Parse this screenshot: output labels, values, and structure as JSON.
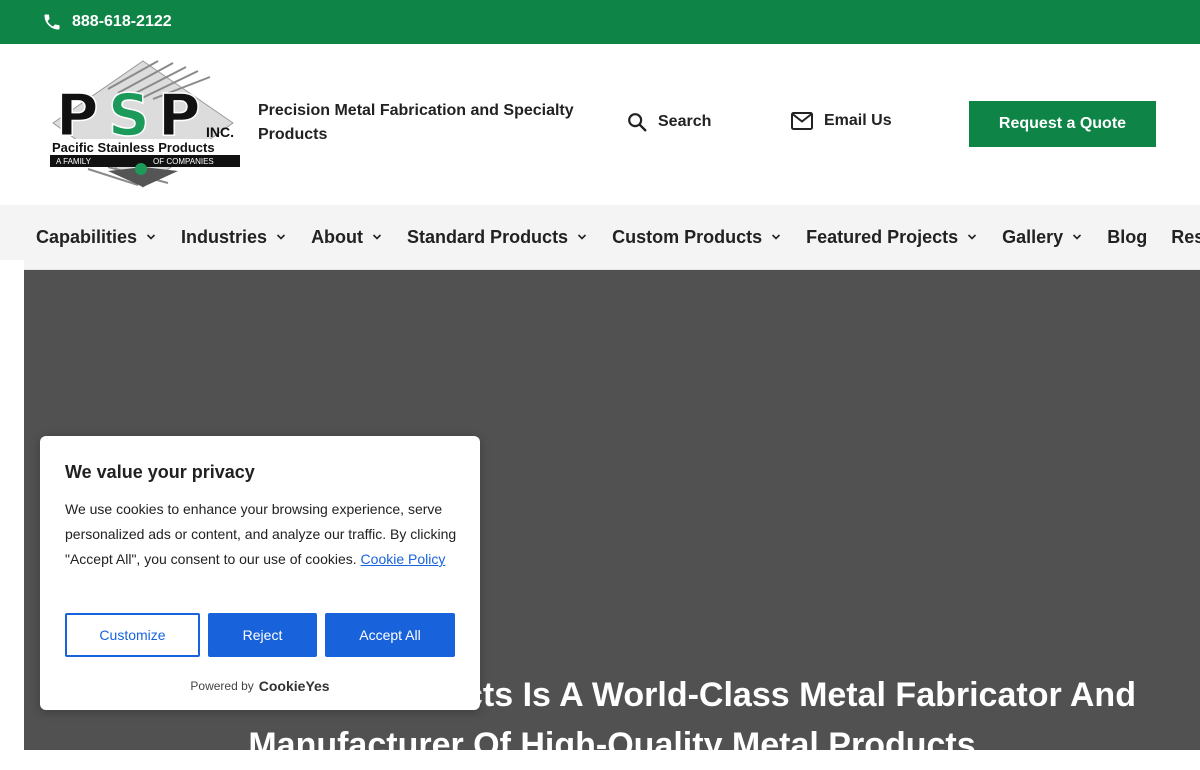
{
  "topbar": {
    "phone": "888-618-2122"
  },
  "header": {
    "logo": {
      "main": "PSP",
      "inc": "INC.",
      "company": "Pacific Stainless Products",
      "sub_left": "A FAMILY",
      "sub_right": "OF COMPANIES"
    },
    "tagline": "Precision Metal Fabrication and Specialty Products",
    "search_label": "Search",
    "email_label": "Email Us",
    "quote_label": "Request a Quote"
  },
  "nav": {
    "items": [
      {
        "label": "Capabilities",
        "dropdown": true
      },
      {
        "label": "Industries",
        "dropdown": true
      },
      {
        "label": "About",
        "dropdown": true
      },
      {
        "label": "Standard Products",
        "dropdown": true
      },
      {
        "label": "Custom Products",
        "dropdown": true
      },
      {
        "label": "Featured Projects",
        "dropdown": true
      },
      {
        "label": "Gallery",
        "dropdown": true
      },
      {
        "label": "Blog",
        "dropdown": false
      },
      {
        "label": "Res",
        "dropdown": false
      }
    ]
  },
  "hero": {
    "title": "Pacific Stainless Products Is A World-Class Metal Fabricator And Manufacturer Of High-Quality Metal Products"
  },
  "cookie": {
    "title": "We value your privacy",
    "description": "We use cookies to enhance your browsing experience, serve personalized ads or content, and analyze our traffic. By clicking \"Accept All\", you consent to our use of cookies.",
    "policy_link": "Cookie Policy",
    "customize": "Customize",
    "reject": "Reject",
    "accept": "Accept All",
    "powered_by": "Powered by",
    "brand": "CookieYes"
  },
  "colors": {
    "brand_green": "#0e8446",
    "hero_gray": "#515151",
    "cookie_blue": "#1863dc"
  }
}
